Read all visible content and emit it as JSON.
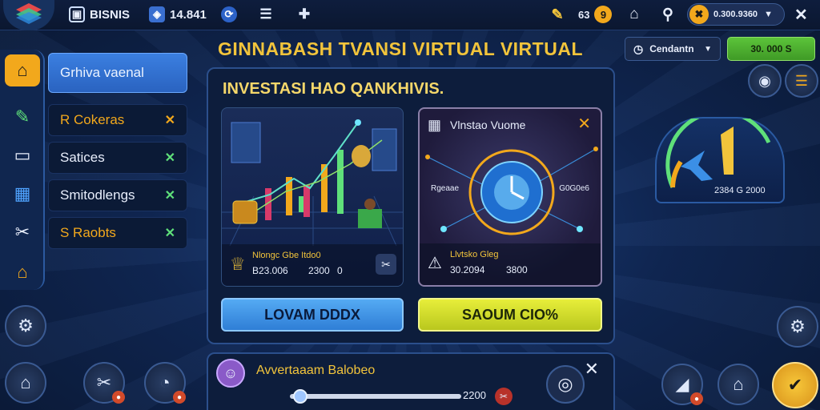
{
  "topbar": {
    "app_name": "BISNIS",
    "counter": "14.841",
    "notif_count": "63",
    "notif_badge": "9",
    "profile": "0.300.9360"
  },
  "header": {
    "title": "GINNABASH TVANSI VIRTUAL VIRTUAL",
    "dropdown": "Cendantn",
    "balance": "30. 000 S"
  },
  "sidebar": {
    "items": [
      {
        "label": "Grhiva vaenal"
      },
      {
        "label": "R Cokeras"
      },
      {
        "label": "Satices"
      },
      {
        "label": "Smitodlengs"
      },
      {
        "label": "S Raobts"
      }
    ]
  },
  "panel": {
    "title": "INVESTASI HAO QANKHIVIS.",
    "card1": {
      "caption": "Nlongc Gbe Itdo0",
      "value1": "B23.006",
      "value2": "2300",
      "value3": "0"
    },
    "card2": {
      "title": "Vlnstao Vuome",
      "left_label": "Rgeaae",
      "right_label": "G0G0e6",
      "caption": "Llvtsko Gleg",
      "value1": "30.2094",
      "value2": "3800"
    },
    "button_left": "LOVAM DDDX",
    "button_right": "SAOUM CIO%"
  },
  "bottom": {
    "title": "Avvertaaam Balobeo",
    "slider_value": "2200",
    "slider_fraction": 0.02
  },
  "gauge": {
    "value": "2384 G 2000"
  },
  "colors": {
    "accent_gold": "#f2c43b",
    "lime": "#c7d41f",
    "blue": "#3b8fe6",
    "green": "#5fe07a"
  }
}
